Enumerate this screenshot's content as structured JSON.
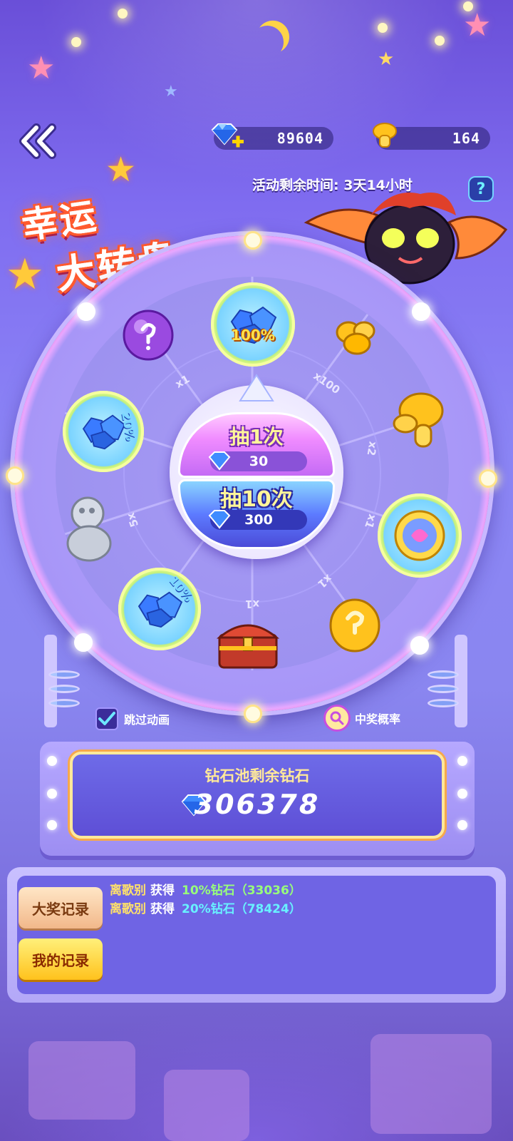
{
  "currency": {
    "diamonds": "89604",
    "mushrooms": "164"
  },
  "event": {
    "title_line1": "幸运",
    "title_line2": "大转盘",
    "timer_label": "活动剩余时间:",
    "timer_value": "3天14小时",
    "help": "?"
  },
  "wheel": {
    "prizes": [
      {
        "label": "100%",
        "icon": "diamond-pile-icon"
      },
      {
        "label": "",
        "icon": "gold-coins-icon"
      },
      {
        "label": "",
        "icon": "gold-mushroom-icon"
      },
      {
        "label": "",
        "icon": "swirl-egg-icon"
      },
      {
        "label": "",
        "icon": "gold-mystery-egg-icon"
      },
      {
        "label": "",
        "icon": "treasure-chest-icon"
      },
      {
        "label": "10%",
        "icon": "diamond-pile-icon"
      },
      {
        "label": "",
        "icon": "silver-mushroom-icon"
      },
      {
        "label": "20%",
        "icon": "diamond-pile-icon"
      },
      {
        "label": "",
        "icon": "purple-mystery-orb-icon"
      }
    ],
    "multipliers": {
      "m_top_left": "x1",
      "m_top_right": "x100",
      "m_right_upper": "x2",
      "m_right": "x1",
      "m_right_lower": "x1",
      "m_bottom": "x1",
      "m_left": "5x"
    }
  },
  "draw": {
    "single_label": "抽1次",
    "single_cost": "30",
    "ten_label": "抽10次",
    "ten_cost": "300"
  },
  "options": {
    "skip_animation": "跳过动画",
    "odds": "中奖概率"
  },
  "pool": {
    "title": "钻石池剩余钻石",
    "value": "306378"
  },
  "records": {
    "tabs": [
      "大奖记录",
      "我的记录"
    ],
    "entries": [
      {
        "name": "离歌别",
        "verb": "获得",
        "item": "10%钻石（33036）"
      },
      {
        "name": "离歌别",
        "verb": "获得",
        "item": "20%钻石（78424）"
      }
    ]
  },
  "colors": {
    "accent_gold": "#ffe14a",
    "record_green": "#98ff7a",
    "record_cyan": "#68f1ff"
  }
}
